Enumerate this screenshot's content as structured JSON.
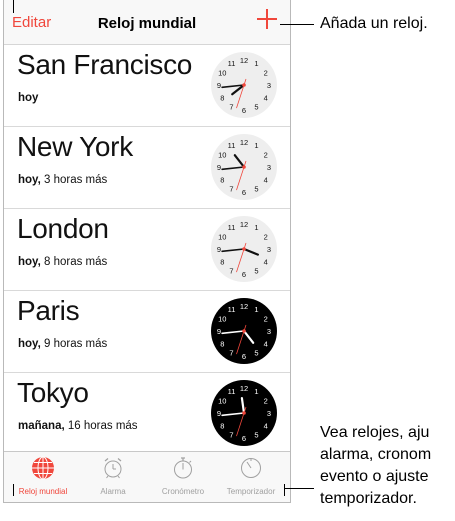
{
  "navbar": {
    "edit_label": "Editar",
    "title": "Reloj mundial"
  },
  "clocks": [
    {
      "city": "San Francisco",
      "day": "hoy",
      "offset": "",
      "hour": 7,
      "minute": 44,
      "second": 33,
      "face": "light"
    },
    {
      "city": "New York",
      "day": "hoy,",
      "offset": " 3 horas más",
      "hour": 10,
      "minute": 44,
      "second": 33,
      "face": "light"
    },
    {
      "city": "London",
      "day": "hoy,",
      "offset": " 8 horas más",
      "hour": 3,
      "minute": 44,
      "second": 33,
      "face": "light"
    },
    {
      "city": "Paris",
      "day": "hoy,",
      "offset": " 9 horas más",
      "hour": 4,
      "minute": 44,
      "second": 33,
      "face": "dark"
    },
    {
      "city": "Tokyo",
      "day": "mañana,",
      "offset": " 16 horas más",
      "hour": 11,
      "minute": 44,
      "second": 33,
      "face": "dark"
    }
  ],
  "tabs": [
    {
      "label": "Reloj mundial",
      "icon": "globe-icon",
      "active": true
    },
    {
      "label": "Alarma",
      "icon": "alarm-clock-icon",
      "active": false
    },
    {
      "label": "Cronómetro",
      "icon": "stopwatch-icon",
      "active": false
    },
    {
      "label": "Temporizador",
      "icon": "timer-icon",
      "active": false
    }
  ],
  "callouts": {
    "add": "Añada un reloj.",
    "tabs_line1": "Vea relojes, aju",
    "tabs_line2": "alarma, cronom",
    "tabs_line3": "evento o ajuste",
    "tabs_line4": "temporizador."
  },
  "colors": {
    "accent": "#f0473c",
    "face_light": "#eeeeee",
    "face_dark": "#000000"
  }
}
